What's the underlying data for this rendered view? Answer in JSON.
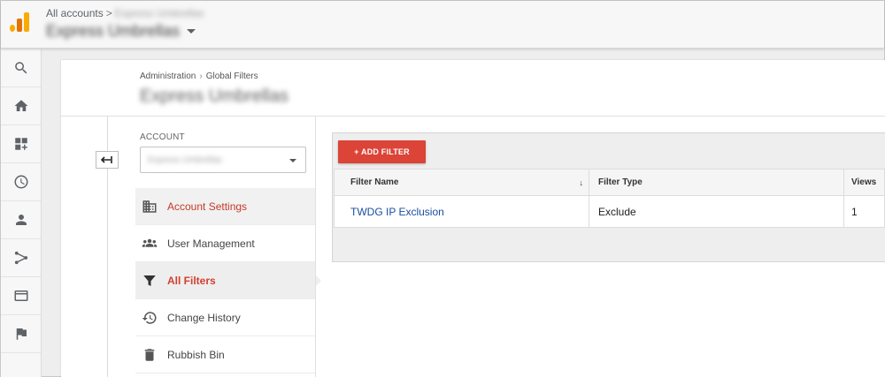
{
  "header": {
    "all_accounts": "All accounts",
    "account_sub": "Express Umbrellas",
    "account_name": "Express Umbrellas"
  },
  "rail": {
    "icons": [
      "search-icon",
      "home-icon",
      "dashboard-icon",
      "clock-icon",
      "person-icon",
      "branch-icon",
      "display-icon",
      "flag-icon"
    ]
  },
  "breadcrumb": {
    "administration": "Administration",
    "global_filters": "Global Filters"
  },
  "page": {
    "title": "Express Umbrellas"
  },
  "account": {
    "label": "ACCOUNT",
    "selected": "Express Umbrellas"
  },
  "nav": {
    "items": [
      {
        "label": "Account Settings",
        "icon": "building-icon"
      },
      {
        "label": "User Management",
        "icon": "people-icon"
      },
      {
        "label": "All Filters",
        "icon": "funnel-icon"
      },
      {
        "label": "Change History",
        "icon": "history-icon"
      },
      {
        "label": "Rubbish Bin",
        "icon": "trash-icon"
      }
    ]
  },
  "filters": {
    "add_label": "+ ADD FILTER",
    "columns": [
      "Filter Name",
      "Filter Type",
      "Views"
    ],
    "sort_indicator": "↓",
    "rows": [
      {
        "name": "TWDG IP Exclusion",
        "type": "Exclude",
        "views": "1"
      }
    ]
  },
  "colors": {
    "accent_red": "#db4437",
    "link_blue": "#1a4ea0",
    "logo_yellow": "#f9ab00",
    "logo_orange": "#e37400"
  }
}
